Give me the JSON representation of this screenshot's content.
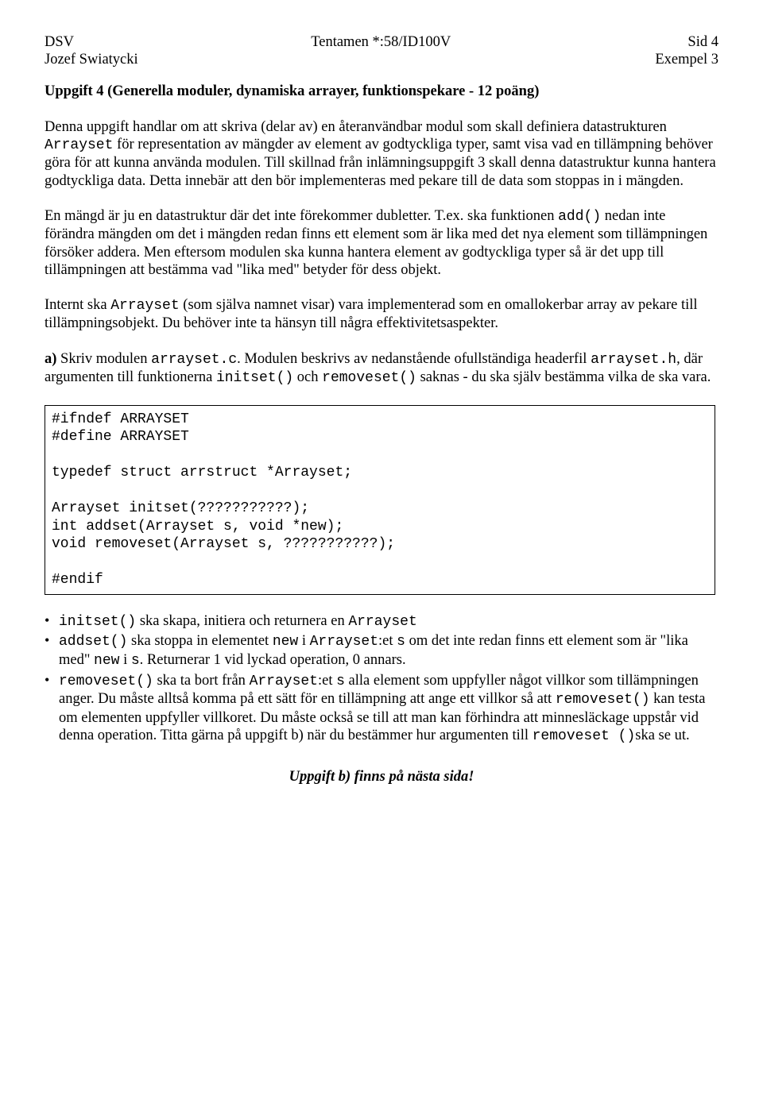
{
  "header": {
    "left_top": "DSV",
    "center_top": "Tentamen *:58/ID100V",
    "right_top": "Sid 4",
    "left_bottom": "Jozef Swiatycki",
    "right_bottom": "Exempel 3"
  },
  "title": "Uppgift 4 (Generella moduler, dynamiska arrayer, funktionspekare - 12 poäng)",
  "para1": {
    "t1": "Denna uppgift handlar om att skriva (delar av) en återanvändbar modul som skall definiera datastrukturen ",
    "code1": "Arrayset",
    "t2": " för representation av mängder av element av godtyckliga typer, samt visa vad en tillämpning behöver göra för att kunna använda modulen. Till skillnad från inlämningsuppgift 3 skall denna datastruktur kunna hantera godtyckliga data. Detta innebär att den bör implementeras med pekare till de data som stoppas in i mängden."
  },
  "para2": {
    "t1": "En mängd är ju en datastruktur där det inte förekommer dubletter. T.ex. ska funktionen ",
    "code1": "add()",
    "t2": " nedan inte förändra mängden om det i mängden redan finns ett element som är lika med det nya element som tillämpningen försöker addera. Men eftersom modulen ska kunna hantera element av godtyckliga typer så är det upp till tillämpningen att bestämma vad \"lika med\" betyder för dess objekt."
  },
  "para3": {
    "t1": "Internt ska ",
    "code1": "Arrayset",
    "t2": " (som själva namnet visar) vara implementerad som en omallokerbar array av pekare till tillämpningsobjekt. Du behöver inte ta hänsyn till några effektivitetsaspekter."
  },
  "para4": {
    "bold_a": "a)",
    "t1": " Skriv modulen ",
    "code1": "arrayset.c",
    "t2": ". Modulen beskrivs av nedanstående ofullständiga headerfil ",
    "code2": "arrayset.h",
    "t3": ", där argumenten till funktionerna ",
    "code3": "initset()",
    "t4": " och ",
    "code4": "removeset()",
    "t5": " saknas - du ska själv bestämma vilka de ska vara."
  },
  "codebox": "#ifndef ARRAYSET\n#define ARRAYSET\n\ntypedef struct arrstruct *Arrayset;\n\nArrayset initset(???????????);\nint addset(Arrayset s, void *new);\nvoid removeset(Arrayset s, ???????????);\n\n#endif",
  "bullets": [
    {
      "c1": "initset()",
      "t1": " ska skapa, initiera och returnera en ",
      "c2": "Arrayset",
      "t2": ""
    },
    {
      "c1": "addset()",
      "t1": " ska stoppa in elementet ",
      "c2": "new",
      "t2": " i ",
      "c3": "Arrayset",
      "t3": ":et ",
      "c4": "s",
      "t4": " om det inte redan finns ett element som är \"lika med\" ",
      "c5": "new",
      "t5": "  i ",
      "c6": "s",
      "t6": ". Returnerar 1 vid lyckad operation, 0 annars."
    },
    {
      "c1": "removeset()",
      "t1": " ska ta bort från ",
      "c2": "Arrayset",
      "t2": ":et ",
      "c3": "s",
      "t3": "  alla element som uppfyller något villkor som tillämpningen anger. Du måste alltså komma på ett sätt för en tillämpning att ange ett villkor så att ",
      "c4": "removeset()",
      "t4": " kan testa om elementen uppfyller villkoret. Du måste också se till att man kan förhindra att minnesläckage uppstår vid denna operation. Titta gärna på uppgift b) när du bestämmer hur argumenten till ",
      "c5": "removeset ()",
      "t5": "ska se ut."
    }
  ],
  "footer": "Uppgift b) finns på nästa sida!"
}
